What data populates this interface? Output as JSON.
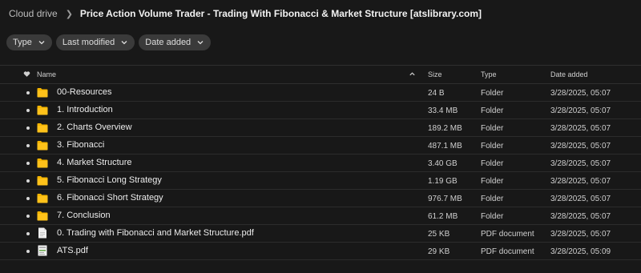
{
  "breadcrumb": {
    "root": "Cloud drive",
    "current": "Price Action Volume Trader - Trading With Fibonacci & Market Structure [atslibrary.com]"
  },
  "filters": [
    {
      "label": "Type"
    },
    {
      "label": "Last modified"
    },
    {
      "label": "Date added"
    }
  ],
  "columns": {
    "name": "Name",
    "size": "Size",
    "type": "Type",
    "date_added": "Date added"
  },
  "colors": {
    "background": "#181818",
    "folder": "#f4b400",
    "chip": "#3a3a3a"
  },
  "files": [
    {
      "name": "00-Resources",
      "size": "24 B",
      "type": "Folder",
      "date": "3/28/2025, 05:07",
      "icon": "folder-icon"
    },
    {
      "name": "1. Introduction",
      "size": "33.4 MB",
      "type": "Folder",
      "date": "3/28/2025, 05:07",
      "icon": "folder-icon"
    },
    {
      "name": "2. Charts Overview",
      "size": "189.2 MB",
      "type": "Folder",
      "date": "3/28/2025, 05:07",
      "icon": "folder-icon"
    },
    {
      "name": "3. Fibonacci",
      "size": "487.1 MB",
      "type": "Folder",
      "date": "3/28/2025, 05:07",
      "icon": "folder-icon"
    },
    {
      "name": "4. Market Structure",
      "size": "3.40 GB",
      "type": "Folder",
      "date": "3/28/2025, 05:07",
      "icon": "folder-icon"
    },
    {
      "name": "5. Fibonacci Long Strategy",
      "size": "1.19 GB",
      "type": "Folder",
      "date": "3/28/2025, 05:07",
      "icon": "folder-icon"
    },
    {
      "name": "6. Fibonacci Short Strategy",
      "size": "976.7 MB",
      "type": "Folder",
      "date": "3/28/2025, 05:07",
      "icon": "folder-icon"
    },
    {
      "name": "7. Conclusion",
      "size": "61.2 MB",
      "type": "Folder",
      "date": "3/28/2025, 05:07",
      "icon": "folder-icon"
    },
    {
      "name": "0. Trading with Fibonacci and Market Structure.pdf",
      "size": "25 KB",
      "type": "PDF document",
      "date": "3/28/2025, 05:07",
      "icon": "pdf-file-icon"
    },
    {
      "name": "ATS.pdf",
      "size": "29 KB",
      "type": "PDF document",
      "date": "3/28/2025, 05:09",
      "icon": "pdf-thumbnail-icon"
    }
  ]
}
